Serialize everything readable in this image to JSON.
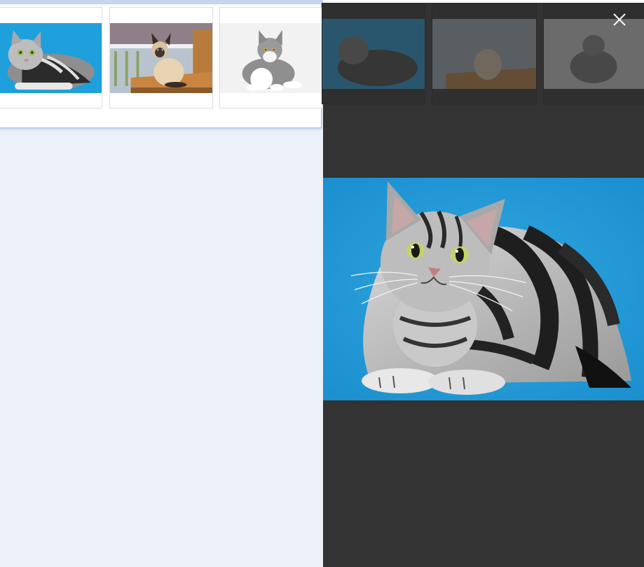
{
  "page": {
    "left_background": "#ebf0f9",
    "right_background": "#333333"
  },
  "thumbnails": [
    {
      "name": "silver-tabby-cat",
      "background": "#1fa0dd"
    },
    {
      "name": "siamese-cat-on-table",
      "background": "#a7b5c4"
    },
    {
      "name": "grey-white-kitten",
      "background": "#f2f2f2"
    }
  ],
  "viewer": {
    "close_icon": "close-icon",
    "selected_image": "silver-tabby-cat",
    "image_background": "#2399d6"
  }
}
